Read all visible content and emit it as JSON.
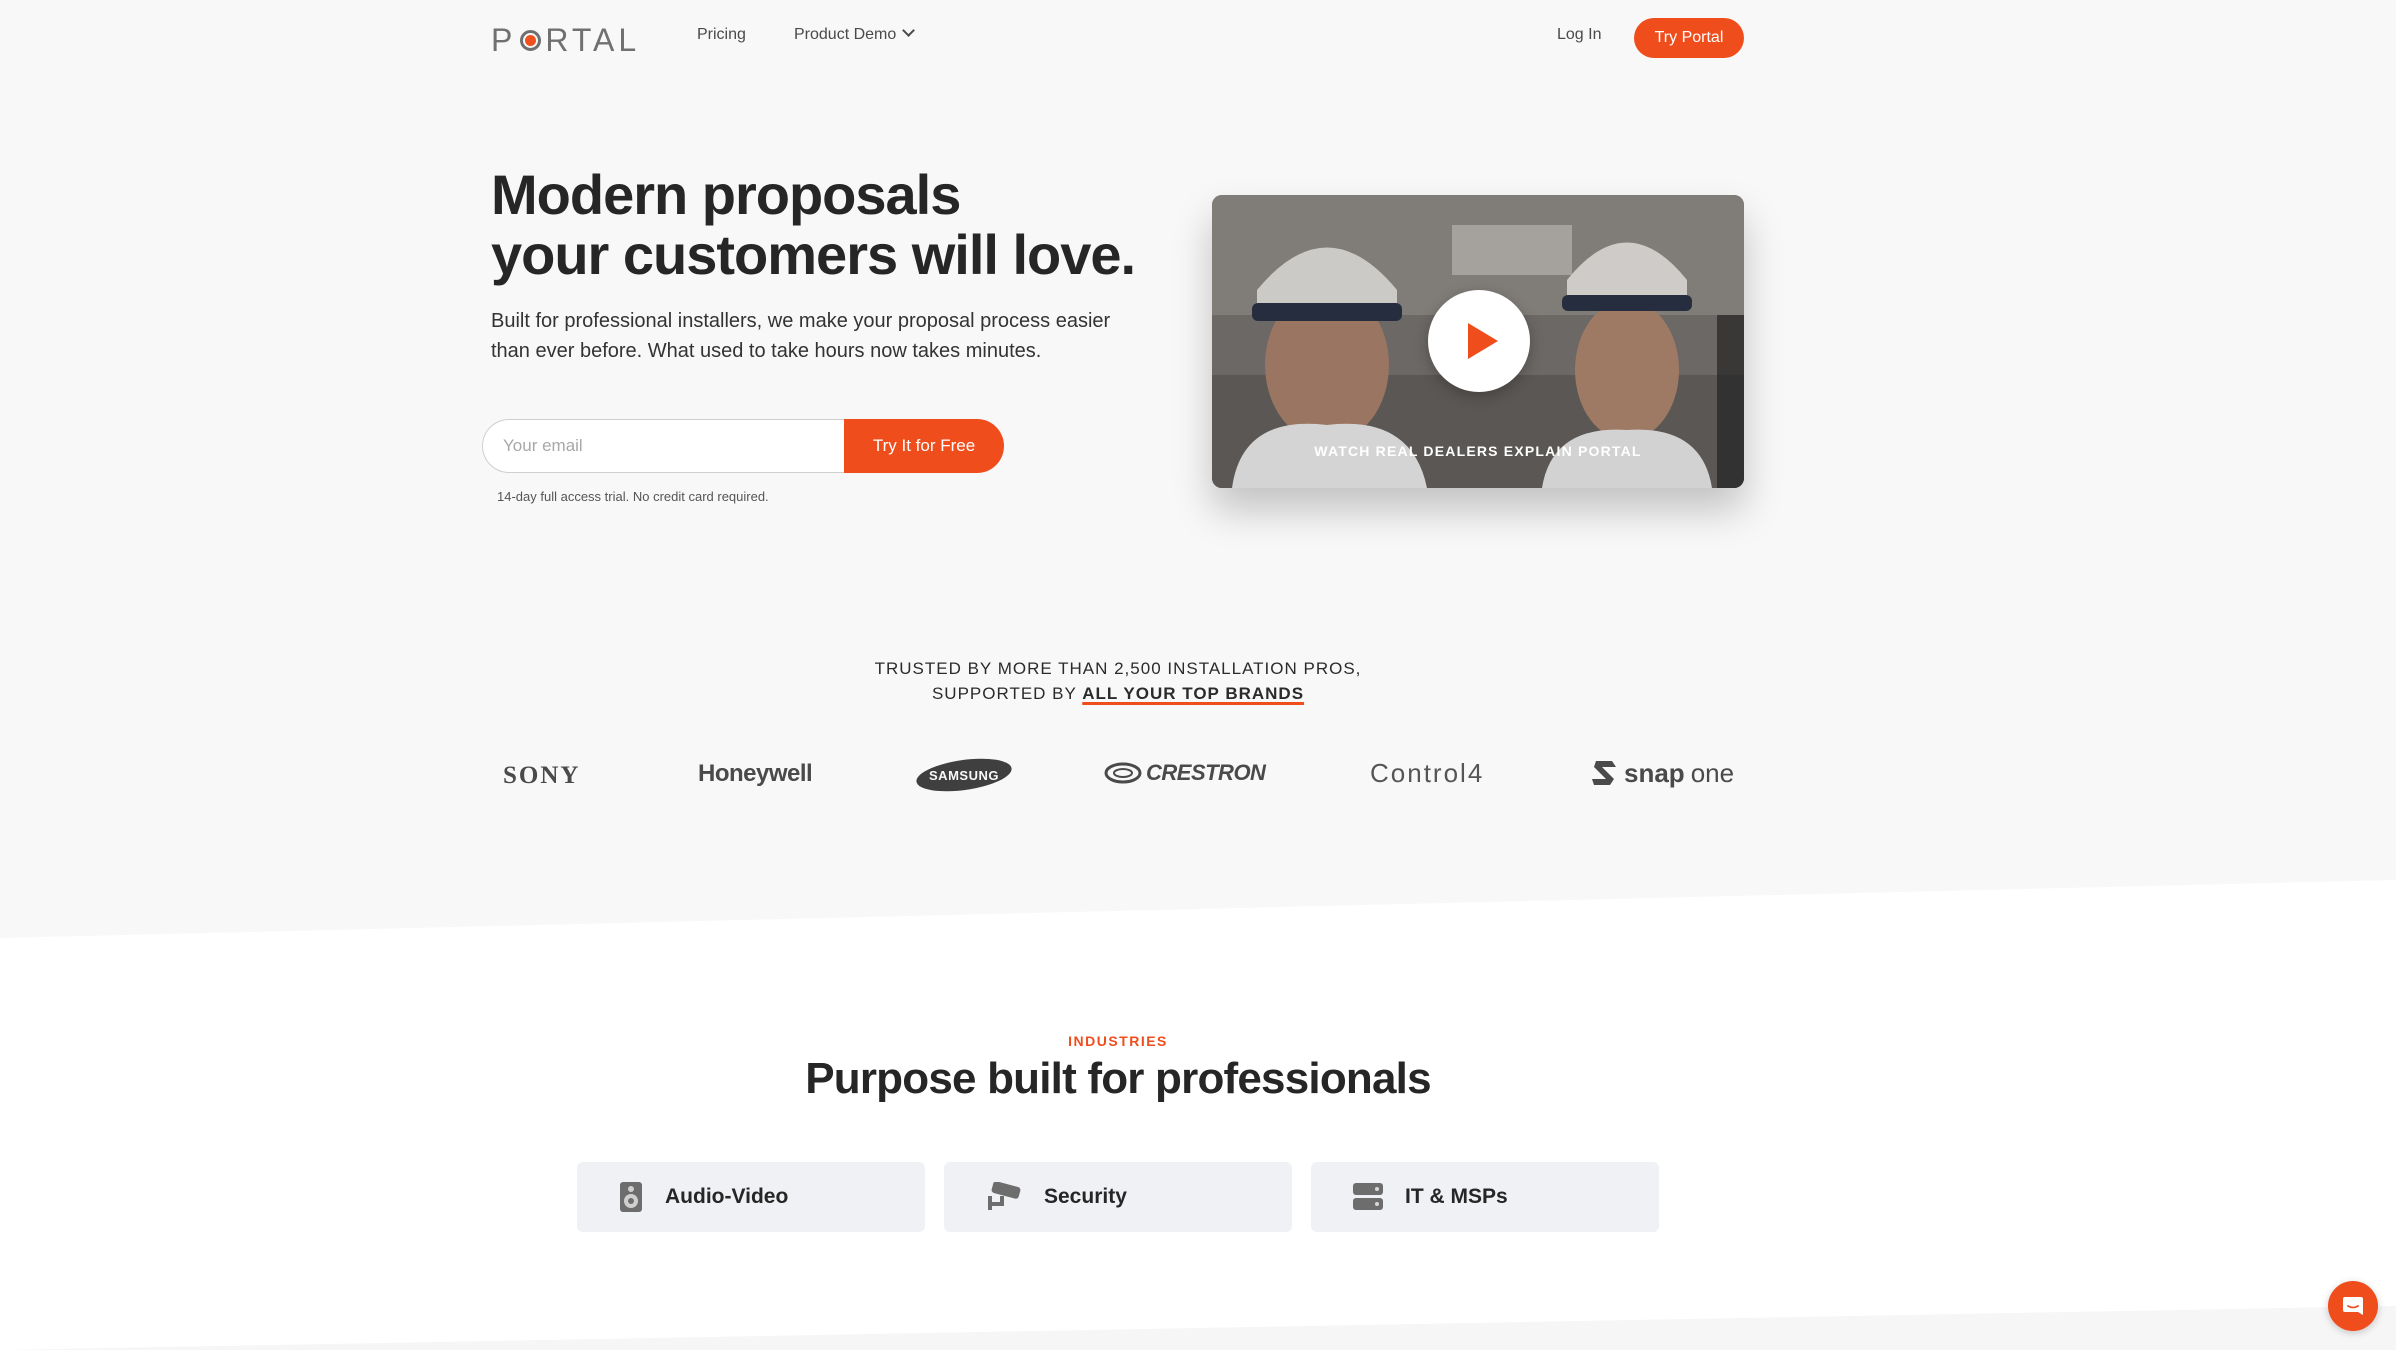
{
  "nav": {
    "logo_text_left": "P",
    "logo_text_right": "RTAL",
    "links": [
      "Pricing",
      "Product Demo"
    ],
    "login": "Log In",
    "cta": "Try Portal"
  },
  "hero": {
    "headline_line1": "Modern proposals",
    "headline_line2": "your customers will love.",
    "subtext": "Built for professional installers, we make your proposal process easier than ever before. What used to take hours now takes minutes.",
    "email_placeholder": "Your email",
    "email_value": "",
    "cta": "Try It for Free",
    "trial_note": "14-day full access trial. No credit card required."
  },
  "video": {
    "caption": "WATCH REAL DEALERS EXPLAIN PORTAL",
    "play_icon": "play-icon"
  },
  "trust": {
    "line1": "TRUSTED BY MORE THAN 2,500 INSTALLATION PROS,",
    "line2_prefix": "SUPPORTED BY ",
    "line2_strong": "ALL YOUR TOP BRANDS"
  },
  "brands": [
    "SONY",
    "Honeywell",
    "SAMSUNG",
    "CRESTRON",
    "Control4",
    "snap",
    "one"
  ],
  "industries": {
    "label": "INDUSTRIES",
    "title": "Purpose built for professionals",
    "cards": [
      {
        "label": "Audio-Video",
        "icon": "speaker-icon"
      },
      {
        "label": "Security",
        "icon": "security-camera-icon"
      },
      {
        "label": "IT & MSPs",
        "icon": "server-icon"
      }
    ]
  },
  "colors": {
    "accent": "#f04d1d",
    "background": "#f8f8f8",
    "card": "#f0f1f5",
    "text": "#262626"
  },
  "chat": {
    "icon": "chat-icon"
  }
}
